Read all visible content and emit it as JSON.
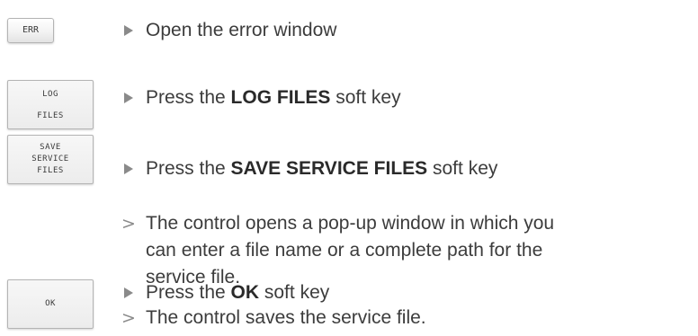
{
  "keys": {
    "err": [
      "ERR"
    ],
    "log_files": [
      "LOG",
      "FILES"
    ],
    "save_service_files": [
      "SAVE",
      "SERVICE",
      "FILES"
    ],
    "ok": [
      "OK"
    ]
  },
  "steps": [
    {
      "marker": "action-arrow",
      "text": "Open the error window"
    },
    {
      "marker": "action-arrow",
      "prefix": "Press the ",
      "bold": "LOG FILES",
      "suffix": " soft key"
    },
    {
      "marker": "action-arrow",
      "prefix": "Press the ",
      "bold": "SAVE SERVICE FILES",
      "suffix": " soft key"
    },
    {
      "marker": "result-chevron",
      "lines": [
        "The control opens a pop-up window in which you",
        "can enter a file name or a complete path for the",
        "service file."
      ]
    },
    {
      "marker": "action-arrow",
      "prefix": "Press the ",
      "bold": "OK",
      "suffix": " soft key"
    },
    {
      "marker": "result-chevron",
      "text": "The control saves the service file."
    }
  ],
  "icons": {
    "action_marker": "triangle-right-icon",
    "result_marker": "chevron-right-icon"
  },
  "colors": {
    "text": "#3c3c3c",
    "marker": "#8a8a8a",
    "key_border": "#b4b4b4"
  }
}
